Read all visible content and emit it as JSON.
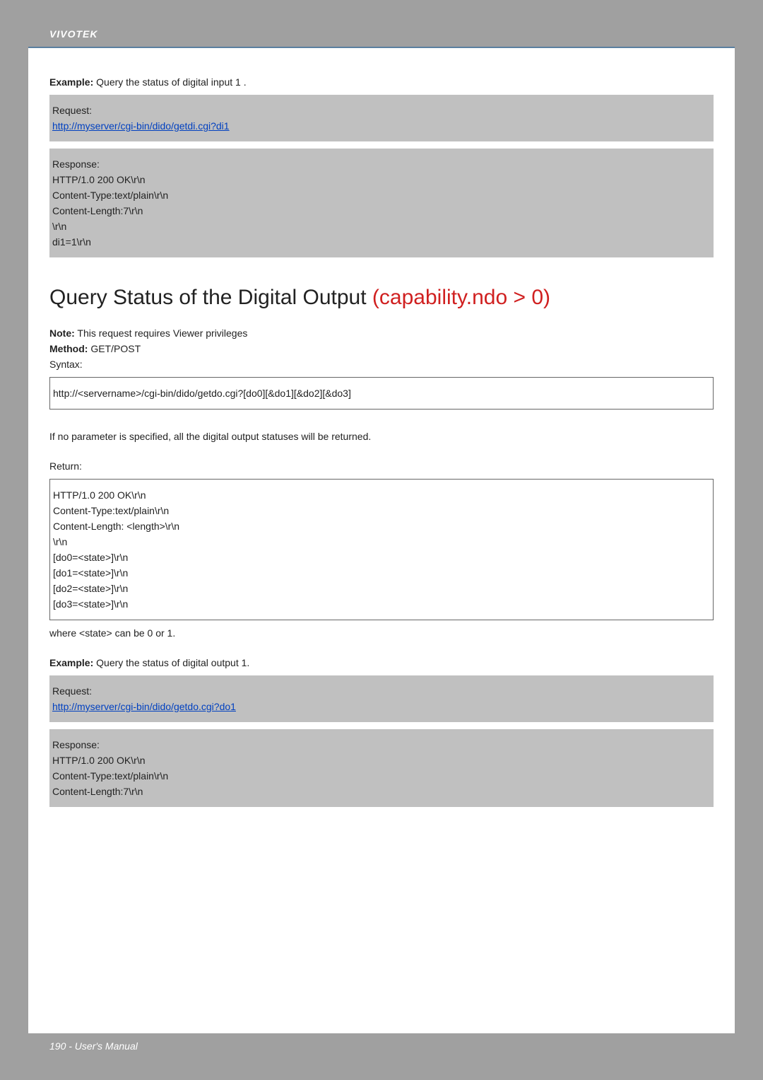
{
  "brand": "VIVOTEK",
  "example1": {
    "label": "Example:",
    "text": "Query the status of digital input 1 .",
    "request_label": "Request:",
    "request_url": "http://myserver/cgi-bin/dido/getdi.cgi?di1",
    "response_label": "Response:",
    "resp_lines": [
      "HTTP/1.0 200 OK\\r\\n",
      "Content-Type:text/plain\\r\\n",
      "Content-Length:7\\r\\n",
      "\\r\\n",
      "di1=1\\r\\n"
    ]
  },
  "heading": {
    "plain": "Query Status of the Digital Output",
    "red": "(capability.ndo > 0)"
  },
  "note": {
    "label": "Note:",
    "text": "This request requires Viewer privileges"
  },
  "method": {
    "label": "Method:",
    "text": "GET/POST"
  },
  "syntax_label": "Syntax:",
  "syntax_box": "http://<servername>/cgi-bin/dido/getdo.cgi?[do0][&do1][&do2][&do3]",
  "noparam": "If no parameter is specified, all the digital output statuses will be returned.",
  "return_label": "Return:",
  "return_lines": [
    "HTTP/1.0 200 OK\\r\\n",
    "Content-Type:text/plain\\r\\n",
    "Content-Length: <length>\\r\\n",
    "\\r\\n",
    "[do0=<state>]\\r\\n",
    "[do1=<state>]\\r\\n",
    "[do2=<state>]\\r\\n",
    "[do3=<state>]\\r\\n"
  ],
  "where_state": "where <state> can be 0 or 1.",
  "example2": {
    "label": "Example:",
    "text": "Query the status of digital output 1.",
    "request_label": "Request:",
    "request_url": "http://myserver/cgi-bin/dido/getdo.cgi?do1",
    "response_label": "Response:",
    "resp_lines": [
      "HTTP/1.0 200 OK\\r\\n",
      "Content-Type:text/plain\\r\\n",
      "Content-Length:7\\r\\n"
    ]
  },
  "footer": "190 - User's Manual"
}
